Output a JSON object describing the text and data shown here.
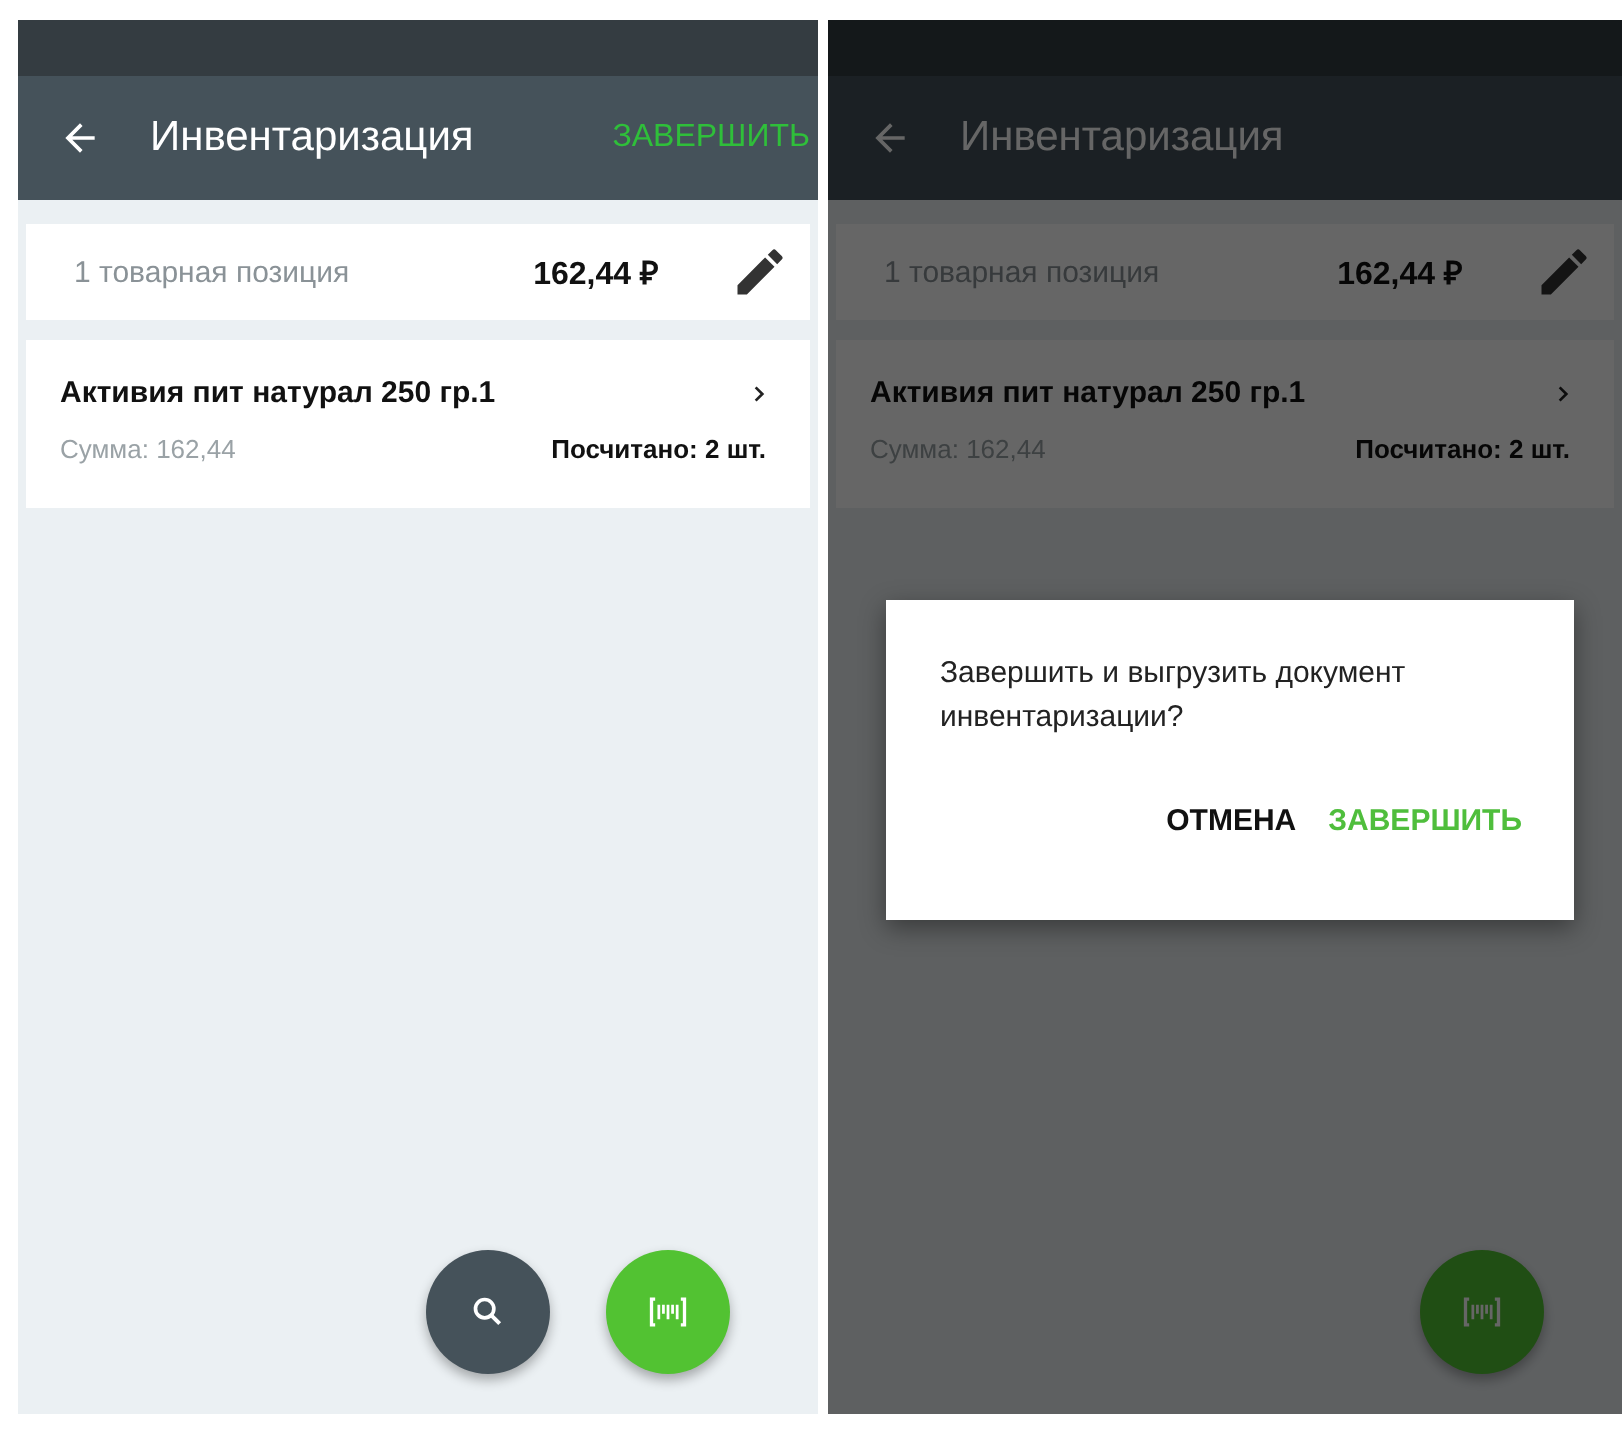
{
  "screens": [
    {
      "toolbar": {
        "title": "Инвентаризация",
        "action": "ЗАВЕРШИТЬ"
      },
      "summary": {
        "count_text": "1 товарная позиция",
        "total": "162,44 ₽"
      },
      "items": [
        {
          "name": "Активия пит натурал 250 гр.1",
          "sum": "Сумма: 162,44",
          "counted": "Посчитано: 2 шт."
        }
      ],
      "fabs": [
        {
          "kind": "search"
        },
        {
          "kind": "barcode"
        }
      ]
    },
    {
      "toolbar": {
        "title": "Инвентаризация"
      },
      "summary": {
        "count_text": "1 товарная позиция",
        "total": "162,44 ₽"
      },
      "items": [
        {
          "name": "Активия пит натурал 250 гр.1",
          "sum": "Сумма: 162,44",
          "counted": "Посчитано: 2 шт."
        }
      ],
      "fabs": [
        {
          "kind": "barcode"
        }
      ],
      "dialog": {
        "message": "Завершить и выгрузить документ инвентаризации?",
        "buttons": [
          {
            "label": "ОТМЕНА",
            "kind": "cancel"
          },
          {
            "label": "ЗАВЕРШИТЬ",
            "kind": "confirm"
          }
        ]
      }
    }
  ]
}
